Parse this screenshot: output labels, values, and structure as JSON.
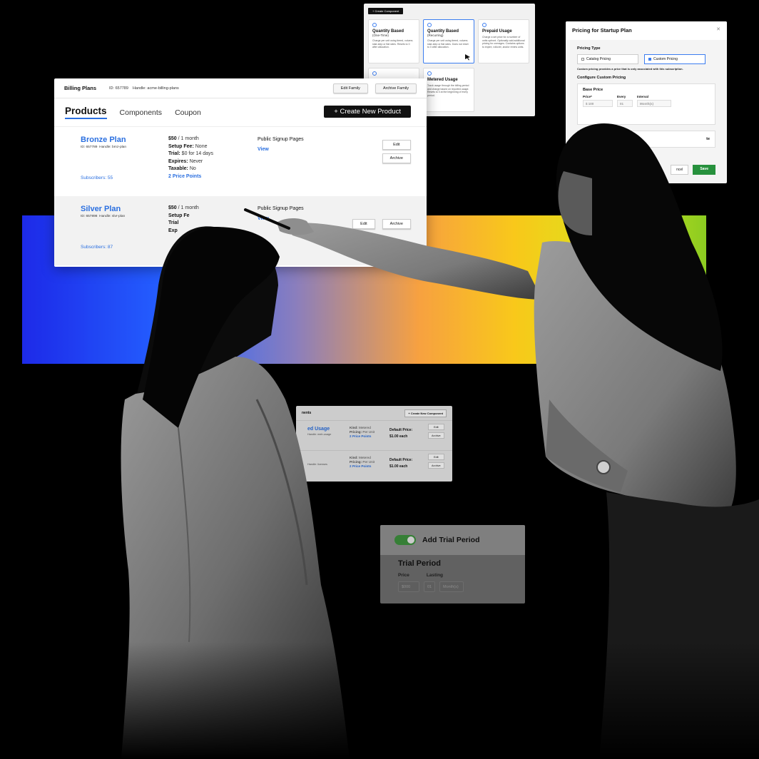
{
  "component_chooser": {
    "top_button": "+ Create Component",
    "tiles": [
      {
        "title": "Quantity Based",
        "subtitle": "(One-Time)",
        "desc": "Charge per unit using tiered, volume, stair-step or flat rates. Resets to 0 after allocation."
      },
      {
        "title": "Quantity Based",
        "subtitle": "(Recurring)",
        "desc": "Charge per unit using tiered, volume, stair-step or flat rates. Does not reset to 0 after allocation."
      },
      {
        "title": "Prepaid Usage",
        "subtitle": "",
        "desc": "Charge a set price for a number of units upfront. Optionally add additional pricing for overages. Contains options to expire, rollover, and/or renew units."
      },
      {
        "title": "",
        "subtitle": "",
        "desc": ""
      },
      {
        "title": "Metered Usage",
        "subtitle": "",
        "desc": "Track usage through the billing period and charge based on reported usage. Resets to 0 at the beginning of every period."
      }
    ]
  },
  "pricing_modal": {
    "title": "Pricing for Startup Plan",
    "pricing_type_label": "Pricing Type",
    "option_catalog": "Catalog Pricing",
    "option_custom": "Custom Pricing",
    "note": "Custom pricing provides a price that is only associated with this subscription.",
    "configure_label": "Configure Custom Pricing",
    "base_price_label": "Base Price",
    "price_label": "Price*",
    "every_label": "Every",
    "interval_label": "Interval",
    "price_value": "$ 100",
    "every_value": "01",
    "interval_value": "Month(s)",
    "second_section_text": "te",
    "cancel_label": "ncel",
    "save_label": "Save"
  },
  "billing_plans": {
    "title": "Billing Plans",
    "id_meta": "ID: 657789",
    "handle_meta": "Handle: acme-billing-plans",
    "edit_family": "Edit Family",
    "archive_family": "Archive Family",
    "tabs": [
      "Products",
      "Components",
      "Coupon"
    ],
    "create_product": "+  Create New Product",
    "plans": [
      {
        "name": "Bronze Plan",
        "id": "ID: 657789",
        "handle": "Handle: brnz-plan",
        "subscribers": "Subscribers: 55",
        "price": "$50",
        "period": " / 1 month",
        "setup_fee_label": "Setup Fee:",
        "setup_fee": " None",
        "trial_label": "Trial:",
        "trial": " $0 for 14 days",
        "expires_label": "Expires:",
        "expires": " Never",
        "taxable_label": "Taxable:",
        "taxable": " No",
        "price_points": "2 Price Points",
        "pages_label": "Public Signup Pages",
        "view_label": "View",
        "edit": "Edit",
        "archive": "Archive"
      },
      {
        "name": "Silver Plan",
        "id": "ID: 657898",
        "handle": "Handle: slvr-plan",
        "subscribers": "Subscribers: 87",
        "price": "$50",
        "period": " / 1 month",
        "setup_fee_label": "Setup Fe",
        "trial_label": "Trial",
        "expires_label": "Exp",
        "pages_label": "Public Signup Pages",
        "view_label": "View",
        "edit": "Edit",
        "archive": "Archive"
      }
    ]
  },
  "components_table": {
    "header": "nents",
    "new_button": "+ Create New Component",
    "rows": [
      {
        "name": "ed Usage",
        "sub": "Handle: metr-usage",
        "kind_label": "Kind:",
        "kind": " Metered",
        "pricing_label": "Pricing:",
        "pricing": " Per Unit",
        "price_points": "2 Price Points",
        "default_label": "Default Price:",
        "default": "$1.00 each",
        "edit": "Edit",
        "archive": "Archive"
      },
      {
        "name": "",
        "sub": "Handle: licenses",
        "kind_label": "Kind:",
        "kind": " Metered",
        "pricing_label": "Pricing:",
        "pricing": " Per Unit",
        "price_points": "2 Price Points",
        "default_label": "Default Price:",
        "default": "$1.00 each",
        "edit": "Edit",
        "archive": "Archive"
      }
    ]
  },
  "trial_card": {
    "toggle_label": "Add Trial Period",
    "title": "Trial Period",
    "price_label": "Price",
    "lasting_label": "Lasting",
    "price_value": "$000",
    "lasting_value": "01",
    "unit_value": "Month(s)"
  },
  "colors": {
    "accent_blue": "#2a6fe0",
    "save_green": "#27913d",
    "toggle_green": "#3b8a3b"
  }
}
